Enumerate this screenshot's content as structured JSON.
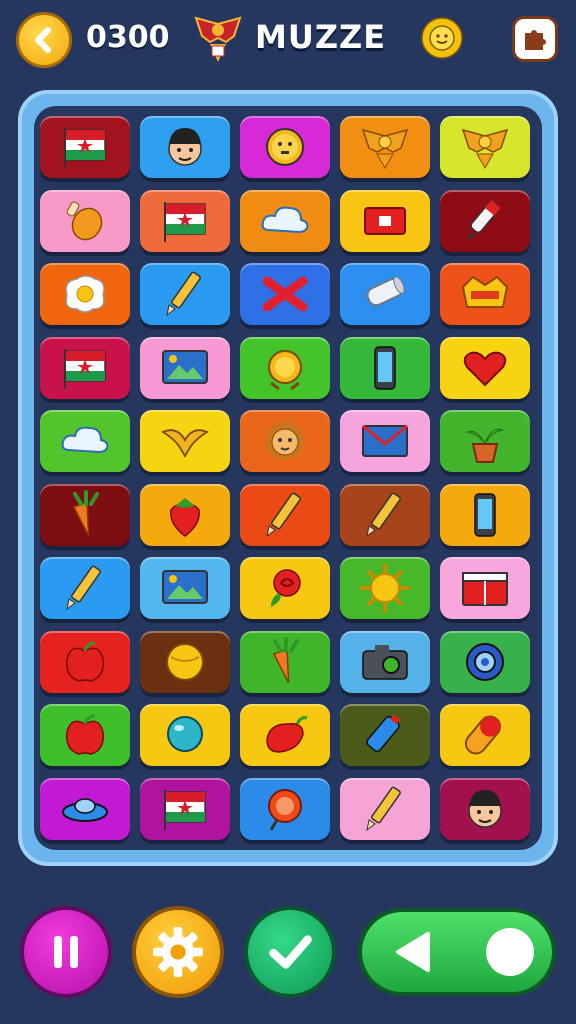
{
  "header": {
    "score": "0300",
    "title": "MUZZE",
    "back_icon": "back-arrow-icon",
    "emblem_icon": "eagle-emblem-icon",
    "coin_icon": "sun-coin-icon",
    "puzzle_icon": "puzzle-piece-icon"
  },
  "board": {
    "rows": [
      [
        {
          "icon": "flag-icon",
          "color": "#a3121f"
        },
        {
          "icon": "boy-face-icon",
          "color": "#2f9ff0"
        },
        {
          "icon": "smiley-coin-icon",
          "color": "#d72ad6"
        },
        {
          "icon": "eagle-emblem-icon",
          "color": "#f08f12"
        },
        {
          "icon": "eagle-emblem-icon",
          "color": "#d6e62a"
        }
      ],
      [
        {
          "icon": "drumstick-icon",
          "color": "#f79ac7"
        },
        {
          "icon": "flag-icon",
          "color": "#f06a3b"
        },
        {
          "icon": "cloud-icon",
          "color": "#f08c12"
        },
        {
          "icon": "red-card-icon",
          "color": "#f7c512"
        },
        {
          "icon": "marker-icon",
          "color": "#8e0d14"
        }
      ],
      [
        {
          "icon": "fried-egg-icon",
          "color": "#f0660f"
        },
        {
          "icon": "pencil-icon",
          "color": "#2a9bf0"
        },
        {
          "icon": "x-mark-icon",
          "color": "#2f70e6"
        },
        {
          "icon": "roller-icon",
          "color": "#2d8ff0"
        },
        {
          "icon": "crown-badge-icon",
          "color": "#ee521a"
        }
      ],
      [
        {
          "icon": "flag-icon",
          "color": "#c9114a"
        },
        {
          "icon": "picture-icon",
          "color": "#f79ad4"
        },
        {
          "icon": "gold-medal-icon",
          "color": "#42c42a"
        },
        {
          "icon": "phone-icon",
          "color": "#35b83a"
        },
        {
          "icon": "heart-box-icon",
          "color": "#f7d412"
        }
      ],
      [
        {
          "icon": "cloud-icon",
          "color": "#52c52a"
        },
        {
          "icon": "bird-icon",
          "color": "#f7d412"
        },
        {
          "icon": "lion-face-icon",
          "color": "#ea661a"
        },
        {
          "icon": "envelope-icon",
          "color": "#f6a4dd"
        },
        {
          "icon": "potted-plant-icon",
          "color": "#43b52d"
        }
      ],
      [
        {
          "icon": "carrot-icon",
          "color": "#7e0d12"
        },
        {
          "icon": "strawberry-icon",
          "color": "#f6a90d"
        },
        {
          "icon": "pencil-icon",
          "color": "#ec4a14"
        },
        {
          "icon": "pencil-icon",
          "color": "#a8441a"
        },
        {
          "icon": "phone-icon",
          "color": "#f6a90d"
        }
      ],
      [
        {
          "icon": "pencil-icon",
          "color": "#2a9bf0"
        },
        {
          "icon": "picture-icon",
          "color": "#53b6ef"
        },
        {
          "icon": "rose-icon",
          "color": "#f7c812"
        },
        {
          "icon": "sun-icon",
          "color": "#46b82a"
        },
        {
          "icon": "red-box-icon",
          "color": "#f7a7dc"
        }
      ],
      [
        {
          "icon": "apple-icon",
          "color": "#e62220"
        },
        {
          "icon": "ball-icon",
          "color": "#6a3010"
        },
        {
          "icon": "carrot-icon",
          "color": "#3fb52a"
        },
        {
          "icon": "camera-icon",
          "color": "#55b2e8"
        },
        {
          "icon": "target-ring-icon",
          "color": "#37b24a"
        }
      ],
      [
        {
          "icon": "apple-icon",
          "color": "#3fbf2a"
        },
        {
          "icon": "teal-ball-icon",
          "color": "#f7c812"
        },
        {
          "icon": "pepper-icon",
          "color": "#f7c812"
        },
        {
          "icon": "battery-icon",
          "color": "#4c5a1a"
        },
        {
          "icon": "capsule-icon",
          "color": "#f7c812"
        }
      ],
      [
        {
          "icon": "ufo-icon",
          "color": "#c21ad2"
        },
        {
          "icon": "flag-icon",
          "color": "#b0149e"
        },
        {
          "icon": "orange-disc-icon",
          "color": "#2a8be8"
        },
        {
          "icon": "pencil-icon",
          "color": "#f6a3d6"
        },
        {
          "icon": "boy-face-icon",
          "color": "#a2114e"
        }
      ]
    ]
  },
  "controls": {
    "pause_icon": "pause-icon",
    "settings_icon": "gear-icon",
    "confirm_icon": "check-icon",
    "toggle_arrow_icon": "left-triangle-icon",
    "toggle_knob": "toggle-knob"
  }
}
